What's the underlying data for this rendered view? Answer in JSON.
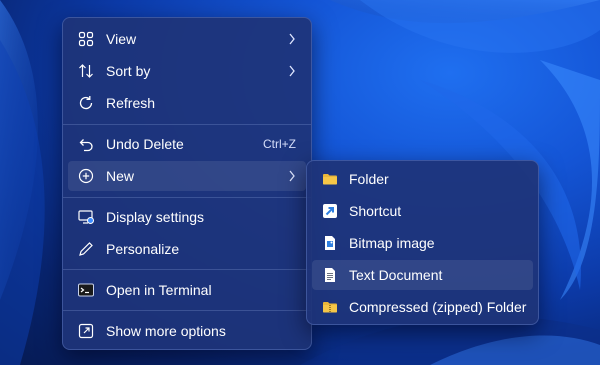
{
  "context_menu": {
    "items": [
      {
        "label": "View",
        "icon": "grid-icon",
        "submenu": true
      },
      {
        "label": "Sort by",
        "icon": "sort-arrows-icon",
        "submenu": true
      },
      {
        "label": "Refresh",
        "icon": "refresh-icon"
      },
      {
        "label": "Undo Delete",
        "icon": "undo-icon",
        "shortcut": "Ctrl+Z"
      },
      {
        "label": "New",
        "icon": "plus-circle-icon",
        "submenu": true,
        "highlighted": true
      },
      {
        "label": "Display settings",
        "icon": "display-settings-icon"
      },
      {
        "label": "Personalize",
        "icon": "pen-icon"
      },
      {
        "label": "Open in Terminal",
        "icon": "terminal-icon"
      },
      {
        "label": "Show more options",
        "icon": "external-link-icon"
      }
    ]
  },
  "new_submenu": {
    "items": [
      {
        "label": "Folder",
        "icon": "folder-icon"
      },
      {
        "label": "Shortcut",
        "icon": "shortcut-icon"
      },
      {
        "label": "Bitmap image",
        "icon": "bitmap-file-icon"
      },
      {
        "label": "Text Document",
        "icon": "text-document-icon",
        "highlighted": true
      },
      {
        "label": "Compressed (zipped) Folder",
        "icon": "zip-folder-icon"
      }
    ]
  },
  "colors": {
    "menu_background": "#1e3478",
    "folder_yellow": "#f5c648",
    "shortcut_blue": "#2f7fe0"
  }
}
